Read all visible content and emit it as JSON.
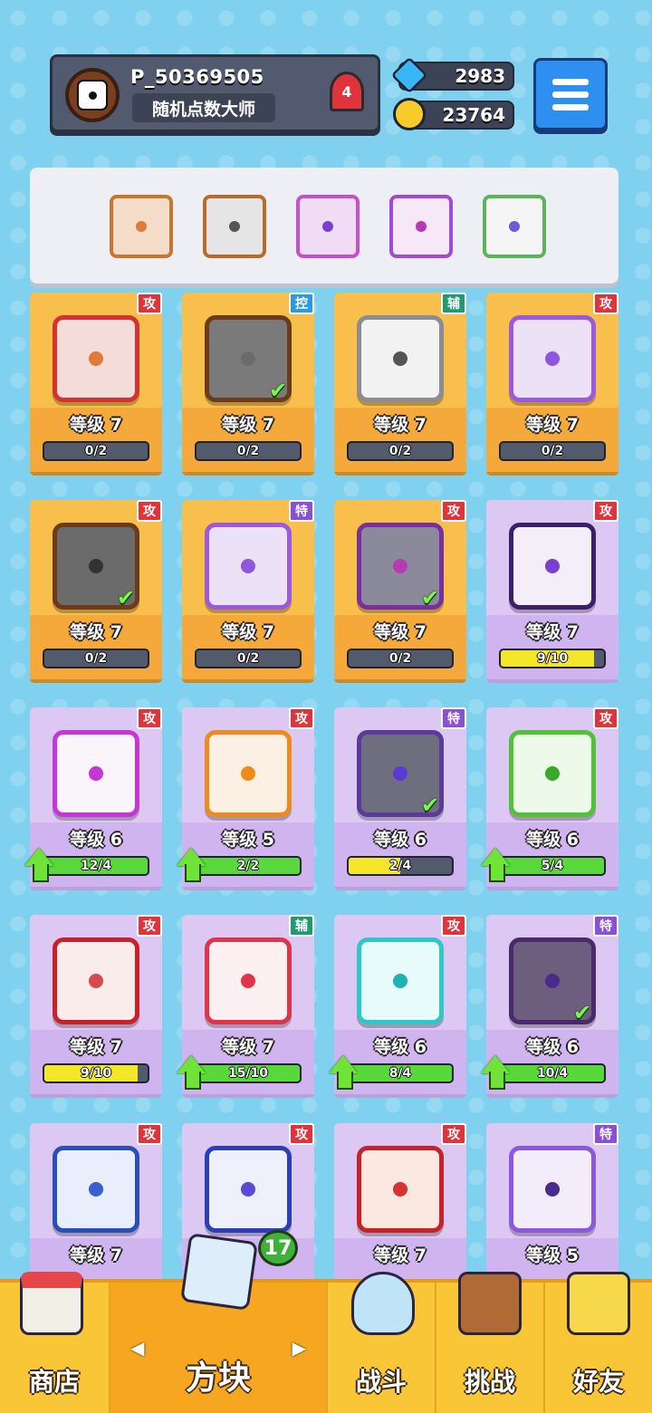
{
  "profile": {
    "username": "P_50369505",
    "title": "随机点数大师",
    "rank": "4"
  },
  "currency": {
    "gems": "2983",
    "coins": "23764"
  },
  "colors": {
    "gem": "#39b6f7",
    "coin": "#f7cc2a",
    "bar_yellow": "#f6e62a",
    "bar_green": "#58d83a"
  },
  "deck": [
    {
      "icon": "sun-dice-icon",
      "frame": "#c8762e",
      "dot": "#e07a38",
      "bg": "#f4dcc9"
    },
    {
      "icon": "gun-dice-icon",
      "frame": "#b86b2b",
      "dot": "#555555",
      "bg": "#e5e5e5"
    },
    {
      "icon": "arrow-dice-icon",
      "frame": "#c64fd0",
      "dot": "#7a3fd0",
      "bg": "#f1dcf5"
    },
    {
      "icon": "combo-dice-icon",
      "frame": "#a04ad8",
      "dot": "#b63bb2",
      "bg": "#f7e8f7"
    },
    {
      "icon": "rainbow-dice-icon",
      "frame": "#5ab55a",
      "dot": "#6b5bd8",
      "bg": "#f5f5f5"
    }
  ],
  "cards": [
    {
      "type": "攻",
      "kind": "atk",
      "rarity": "gold",
      "level": "等级 7",
      "progress": "0/2",
      "pct": 0,
      "bar": "empty",
      "upgrade": false,
      "check": false,
      "frame": "#d63232",
      "dot": "#e07a38",
      "bg": "#f4dcd8"
    },
    {
      "type": "控",
      "kind": "ctl",
      "rarity": "gold",
      "level": "等级 7",
      "progress": "0/2",
      "pct": 0,
      "bar": "empty",
      "upgrade": false,
      "check": true,
      "frame": "#6b3b1b",
      "dot": "#6b6b6b",
      "bg": "#7a7a7a"
    },
    {
      "type": "辅",
      "kind": "sup",
      "rarity": "gold",
      "level": "等级 7",
      "progress": "0/2",
      "pct": 0,
      "bar": "empty",
      "upgrade": false,
      "check": false,
      "frame": "#8c8c96",
      "dot": "#555555",
      "bg": "#f2f2f2"
    },
    {
      "type": "攻",
      "kind": "atk",
      "rarity": "gold",
      "level": "等级 7",
      "progress": "0/2",
      "pct": 0,
      "bar": "empty",
      "upgrade": false,
      "check": false,
      "frame": "#9d58e0",
      "dot": "#8c58e0",
      "bg": "#ece2f7"
    },
    {
      "type": "攻",
      "kind": "atk",
      "rarity": "gold",
      "level": "等级 7",
      "progress": "0/2",
      "pct": 0,
      "bar": "empty",
      "upgrade": false,
      "check": true,
      "frame": "#6b3b1b",
      "dot": "#333333",
      "bg": "#6b6b6b"
    },
    {
      "type": "特",
      "kind": "spc",
      "rarity": "gold",
      "level": "等级 7",
      "progress": "0/2",
      "pct": 0,
      "bar": "empty",
      "upgrade": false,
      "check": false,
      "frame": "#9d58e0",
      "dot": "#8c58e0",
      "bg": "#ece2f7"
    },
    {
      "type": "攻",
      "kind": "atk",
      "rarity": "gold",
      "level": "等级 7",
      "progress": "0/2",
      "pct": 0,
      "bar": "empty",
      "upgrade": false,
      "check": true,
      "frame": "#7a2fa0",
      "dot": "#b63bb2",
      "bg": "#8a8a9a"
    },
    {
      "type": "攻",
      "kind": "atk",
      "rarity": "purple",
      "level": "等级 7",
      "progress": "9/10",
      "pct": 0.9,
      "bar": "yellow",
      "upgrade": false,
      "check": false,
      "frame": "#3a1f6a",
      "dot": "#7a3fd0",
      "bg": "#f3eef8"
    },
    {
      "type": "攻",
      "kind": "atk",
      "rarity": "purple",
      "level": "等级 6",
      "progress": "12/4",
      "pct": 1,
      "bar": "green",
      "upgrade": true,
      "check": false,
      "frame": "#c635d8",
      "dot": "#c635d8",
      "bg": "#faf4fb"
    },
    {
      "type": "攻",
      "kind": "atk",
      "rarity": "purple",
      "level": "等级 5",
      "progress": "2/2",
      "pct": 1,
      "bar": "green",
      "upgrade": true,
      "check": false,
      "frame": "#ef8a1c",
      "dot": "#ef8a1c",
      "bg": "#fbf0e3"
    },
    {
      "type": "特",
      "kind": "spc",
      "rarity": "purple",
      "level": "等级 6",
      "progress": "2/4",
      "pct": 0.5,
      "bar": "yellow",
      "upgrade": false,
      "check": true,
      "frame": "#5a3a9a",
      "dot": "#5a3ad0",
      "bg": "#6e6e7e"
    },
    {
      "type": "攻",
      "kind": "atk",
      "rarity": "purple",
      "level": "等级 6",
      "progress": "5/4",
      "pct": 1,
      "bar": "green",
      "upgrade": true,
      "check": false,
      "frame": "#4fc23a",
      "dot": "#3ba82a",
      "bg": "#eefae9"
    },
    {
      "type": "攻",
      "kind": "atk",
      "rarity": "purple",
      "level": "等级 7",
      "progress": "9/10",
      "pct": 0.9,
      "bar": "yellow",
      "upgrade": false,
      "check": false,
      "frame": "#c8212a",
      "dot": "#d64a4a",
      "bg": "#fbecec"
    },
    {
      "type": "辅",
      "kind": "sup",
      "rarity": "purple",
      "level": "等级 7",
      "progress": "15/10",
      "pct": 1,
      "bar": "green",
      "upgrade": true,
      "check": false,
      "frame": "#e0344a",
      "dot": "#e0344a",
      "bg": "#fdf0f2"
    },
    {
      "type": "攻",
      "kind": "atk",
      "rarity": "purple",
      "level": "等级 6",
      "progress": "8/4",
      "pct": 1,
      "bar": "green",
      "upgrade": true,
      "check": false,
      "frame": "#2ec8c8",
      "dot": "#1fb1b8",
      "bg": "#e8fbfb"
    },
    {
      "type": "特",
      "kind": "spc",
      "rarity": "purple",
      "level": "等级 6",
      "progress": "10/4",
      "pct": 1,
      "bar": "green",
      "upgrade": true,
      "check": true,
      "frame": "#4a2a6a",
      "dot": "#4a2a8a",
      "bg": "#6e5e7e"
    },
    {
      "type": "攻",
      "kind": "atk",
      "rarity": "purple",
      "level": "等级 7",
      "progress": "",
      "pct": 0,
      "bar": "hidden",
      "upgrade": false,
      "check": false,
      "frame": "#2a4fb8",
      "dot": "#3a5fd0",
      "bg": "#e8eefb"
    },
    {
      "type": "攻",
      "kind": "atk",
      "rarity": "purple",
      "level": "",
      "progress": "",
      "pct": 0,
      "bar": "hidden",
      "upgrade": false,
      "check": false,
      "frame": "#2a3fb8",
      "dot": "#5a4ad8",
      "bg": "#eef0fb"
    },
    {
      "type": "攻",
      "kind": "atk",
      "rarity": "purple",
      "level": "等级 7",
      "progress": "",
      "pct": 0,
      "bar": "hidden",
      "upgrade": false,
      "check": false,
      "frame": "#c8212a",
      "dot": "#d63232",
      "bg": "#fbe8e0"
    },
    {
      "type": "特",
      "kind": "spc",
      "rarity": "purple",
      "level": "等级 5",
      "progress": "",
      "pct": 0,
      "bar": "hidden",
      "upgrade": false,
      "check": false,
      "frame": "#8c58e0",
      "dot": "#4a2a8a",
      "bg": "#f2ecfb"
    }
  ],
  "nav": {
    "shop": "商店",
    "dice": "方块",
    "battle": "战斗",
    "challenge": "挑战",
    "friends": "好友",
    "dice_badge": "17",
    "left_arrow": "◀",
    "right_arrow": "▶"
  }
}
